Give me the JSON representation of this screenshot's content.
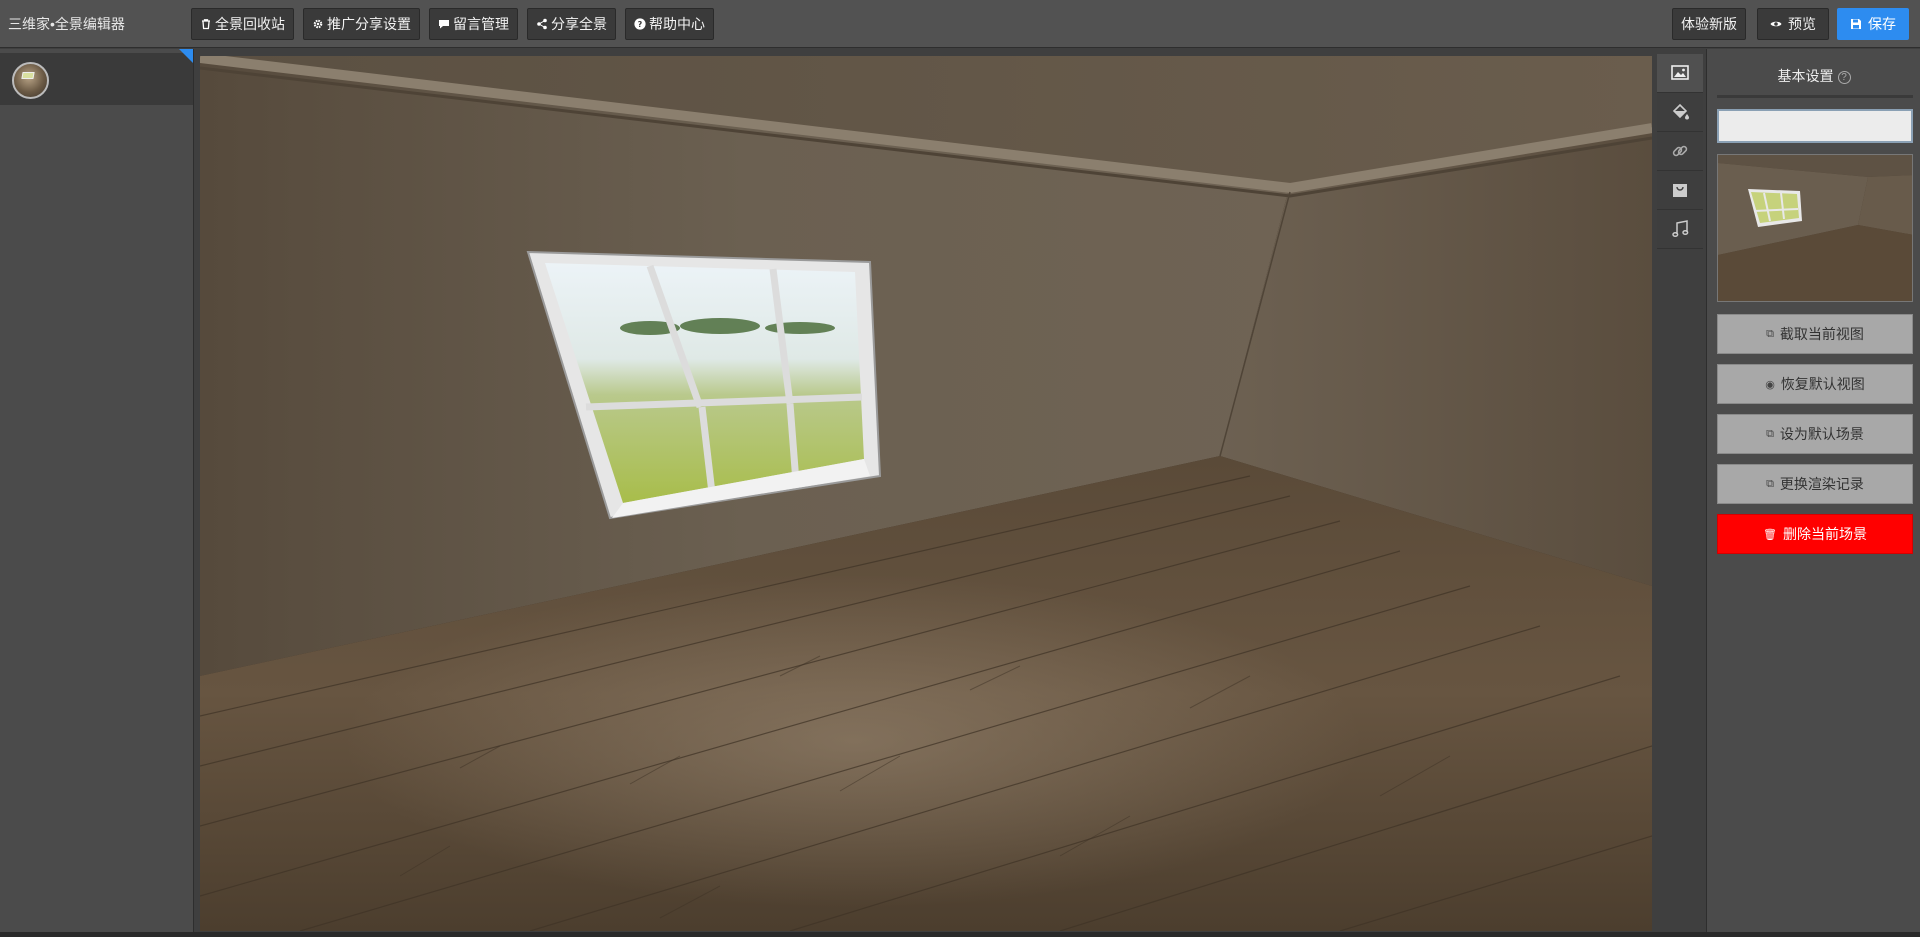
{
  "app": {
    "title": "三维家•全景编辑器"
  },
  "toolbar": {
    "recycle": {
      "label": "全景回收站",
      "icon": "trash-icon"
    },
    "promote": {
      "label": "推广分享设置",
      "icon": "gear-icon"
    },
    "comments": {
      "label": "留言管理",
      "icon": "comment-icon"
    },
    "share": {
      "label": "分享全景",
      "icon": "share-icon"
    },
    "help": {
      "label": "帮助中心",
      "icon": "question-icon"
    },
    "new_version": {
      "label": "体验新版"
    },
    "preview": {
      "label": "预览",
      "icon": "eye-icon"
    },
    "save": {
      "label": "保存",
      "icon": "floppy-icon"
    }
  },
  "scenes": {
    "items": [
      {
        "thumb": "room-thumbnail",
        "selected": true
      }
    ]
  },
  "tools": [
    {
      "name": "image-icon",
      "active": true
    },
    {
      "name": "paint-bucket-icon",
      "active": false
    },
    {
      "name": "link-icon",
      "active": false
    },
    {
      "name": "bag-icon",
      "active": false
    },
    {
      "name": "music-icon",
      "active": false
    }
  ],
  "settings": {
    "title": "基本设置",
    "help_icon": "?",
    "name_value": "",
    "buttons": {
      "capture": "截取当前视图",
      "restore": "恢复默认视图",
      "set_default": "设为默认场景",
      "replace_render": "更换渲染记录",
      "delete": "删除当前场景"
    }
  },
  "colors": {
    "accent": "#2d8cf0",
    "danger": "#ff0000",
    "panel": "#4b4b4b",
    "toolbar": "#525252"
  }
}
